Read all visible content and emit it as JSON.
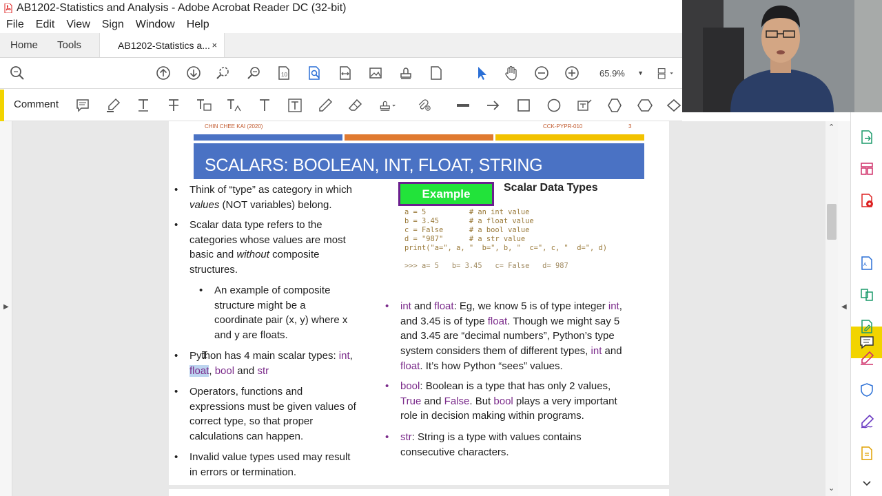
{
  "window": {
    "title": "AB1202-Statistics and Analysis - Adobe Acrobat Reader DC (32-bit)"
  },
  "menu": [
    "File",
    "Edit",
    "View",
    "Sign",
    "Window",
    "Help"
  ],
  "tabs": {
    "home": "Home",
    "tools": "Tools",
    "doc": "AB1202-Statistics a...",
    "close": "×"
  },
  "toolbar": {
    "zoom": "65.9%"
  },
  "commentbar": {
    "label": "Comment"
  },
  "page": {
    "header_left": "CHIN CHEE KAI (2020)",
    "header_mid": "CCK-PYPR-010",
    "header_num": "3",
    "title": "SCALARS: BOOLEAN, INT, FLOAT, STRING",
    "left": {
      "b1_l1": "Think of “type” as category in which",
      "b1_l2a": "values",
      "b1_l2b": " (NOT variables) belong.",
      "b2_l1": "Scalar data type refers to the",
      "b2_l2": "categories whose values are most",
      "b2_l3a": "basic and ",
      "b2_l3b": "without",
      "b2_l3c": " composite",
      "b2_l4": "structures.",
      "s1_l1": "An example of composite",
      "s1_l2": "structure might be a",
      "s1_l3": "coordinate pair (x, y) where x",
      "s1_l4": "and y are floats.",
      "b3_l1": "Python has 4 main scalar types: ",
      "b3_int": "int",
      "b3_comma1": ",",
      "b3_float": "float",
      "b3_comma2": ", ",
      "b3_bool": "bool",
      "b3_and": " and ",
      "b3_str": "str",
      "b4_l1": "Operators, functions and",
      "b4_l2": "expressions must be given values of",
      "b4_l3": "correct type, so that proper",
      "b4_l4": "calculations can happen.",
      "b5_l1": "Invalid value types used may result",
      "b5_l2": "in errors or termination."
    },
    "example_label": "Example",
    "scalar_title": "Scalar Data Types",
    "code": [
      "a = 5          # an int value",
      "b = 3.45       # a float value",
      "c = False      # a bool value",
      "d = \"987\"      # a str value",
      "print(\"a=\", a, \"  b=\", b, \"  c=\", c, \"  d=\", d)"
    ],
    "output": ">>> a= 5   b= 3.45   c= False   d= 987",
    "right": {
      "r1_int": "int",
      "r1_and": " and ",
      "r1_float": "float",
      "r1_rest": ":  Eg, we know 5 is of type integer ",
      "r1_int2": "int",
      "r1_comma": ",",
      "r1_l2a": "and 3.45 is of type ",
      "r1_l2float": "float",
      "r1_l2b": ".  Though we might say 5",
      "r1_l3": "and 3.45 are “decimal numbers”, Python’s type",
      "r1_l4a": "system considers them of different types, ",
      "r1_l4int": "int",
      "r1_l4b": " and",
      "r1_l5float": "float",
      "r1_l5b": ".  It’s how Python “sees” values.",
      "r2_bool": "bool",
      "r2_rest": ":  Boolean is a type that has only 2 values,",
      "r2_true": "True",
      "r2_and": " and ",
      "r2_false": "False",
      "r2_but": ".  But ",
      "r2_bool2": "bool",
      "r2_plays": " plays a very important",
      "r2_l3": "role in decision making within programs.",
      "r3_str": "str",
      "r3_rest": ":  String is a type with values contains",
      "r3_l2": "consecutive characters."
    }
  },
  "colors": {
    "banner": "#4a72c4",
    "bar_blue": "#4a72c4",
    "bar_orange": "#e07a30",
    "bar_yellow": "#f2c200",
    "accent": "#f2d400",
    "purple": "#7a2a8a",
    "example_green": "#22e33a"
  }
}
